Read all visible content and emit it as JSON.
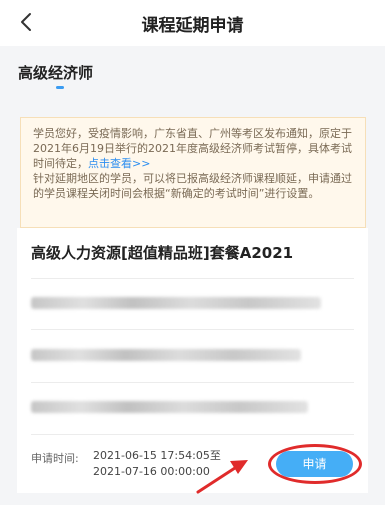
{
  "header": {
    "title": "课程延期申请",
    "back_icon": "chevron-left-icon"
  },
  "tabs": [
    {
      "label": "高级经济师",
      "active": true
    }
  ],
  "notice": {
    "text_before_link": "学员您好，受疫情影响，广东省直、广州等考区发布通知，原定于2021年6月19日举行的2021年度高级经济师考试暂停，具体考试时间待定，",
    "link_text": "点击查看>>",
    "text_after": "针对延期地区的学员，可以将已报高级经济师课程顺延，申请通过的学员课程关闭时间会根据“新确定的考试时间”进行设置。"
  },
  "card": {
    "package_title": "高级人力资源[超值精品班]套餐A2021",
    "time_label": "申请时间:",
    "time_start": "2021-06-15 17:54:05至",
    "time_end": "2021-07-16 00:00:00",
    "apply_button": "申请"
  },
  "colors": {
    "accent": "#45aef6",
    "link": "#2c8ef0",
    "annotation": "#e02b2b",
    "notice_bg": "#fff8ec"
  }
}
